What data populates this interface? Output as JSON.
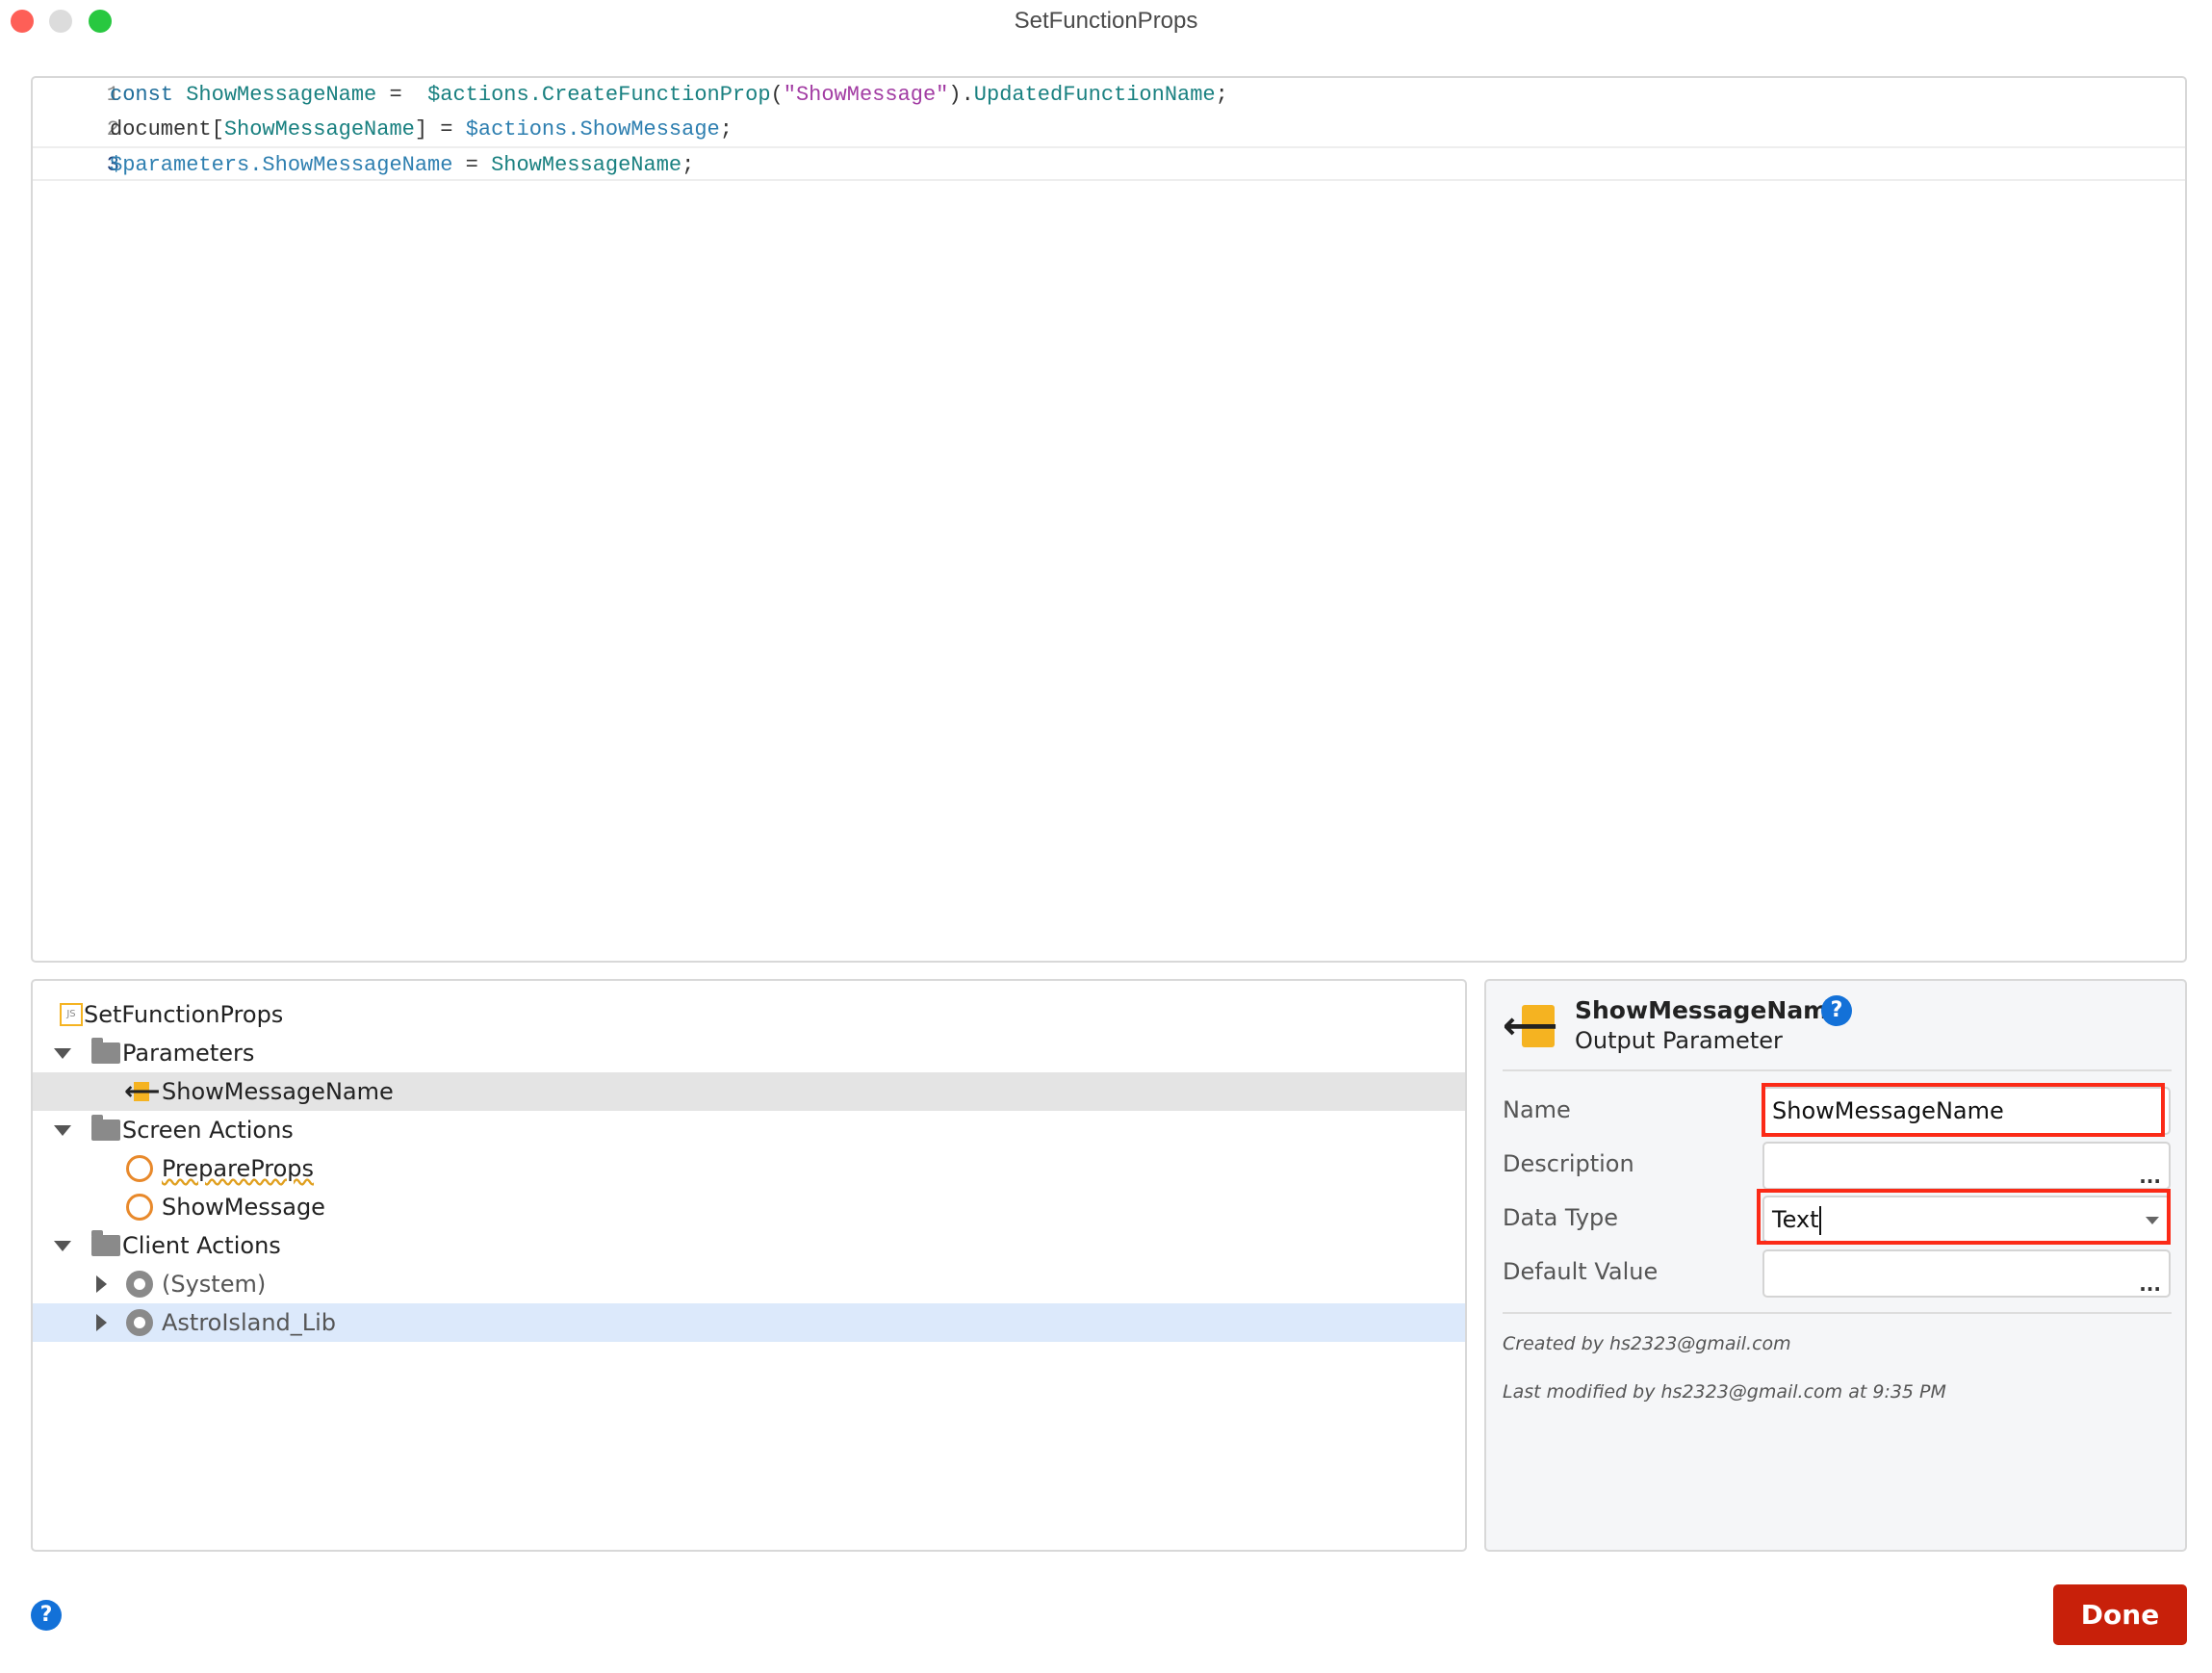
{
  "window": {
    "title": "SetFunctionProps"
  },
  "editor": {
    "lines": [
      {
        "num": "1",
        "tokens": [
          [
            "k",
            "const "
          ],
          [
            "v",
            "ShowMessageName"
          ],
          [
            "p",
            " =  "
          ],
          [
            "v",
            "$actions.CreateFunctionProp"
          ],
          [
            "p",
            "("
          ],
          [
            "s",
            "\"ShowMessage\""
          ],
          [
            "p",
            ")."
          ],
          [
            "v",
            "UpdatedFunctionName"
          ],
          [
            "p",
            ";"
          ]
        ]
      },
      {
        "num": "2",
        "tokens": [
          [
            "p",
            "document["
          ],
          [
            "v",
            "ShowMessageName"
          ],
          [
            "p",
            "] = "
          ],
          [
            "t",
            "$actions.ShowMessage"
          ],
          [
            "p",
            ";"
          ]
        ]
      },
      {
        "num": "3",
        "tokens": [
          [
            "t",
            "$parameters.ShowMessageName"
          ],
          [
            "p",
            " = "
          ],
          [
            "v",
            "ShowMessageName"
          ],
          [
            "p",
            ";"
          ]
        ]
      }
    ]
  },
  "tree": {
    "root": "SetFunctionProps",
    "root_icon": "JS",
    "parameters": "Parameters",
    "param_item": "ShowMessageName",
    "screen_actions": "Screen Actions",
    "screen_items": [
      "PrepareProps",
      "ShowMessage"
    ],
    "client_actions": "Client Actions",
    "client_items": [
      "(System)",
      "AstroIsland_Lib"
    ]
  },
  "props": {
    "title": "ShowMessageName",
    "subtitle": "Output Parameter",
    "fields": {
      "name_label": "Name",
      "name_value": "ShowMessageName",
      "description_label": "Description",
      "description_value": "",
      "datatype_label": "Data Type",
      "datatype_value": "Text",
      "default_label": "Default Value",
      "default_value": ""
    },
    "created": "Created by hs2323@gmail.com",
    "modified": "Last modified by hs2323@gmail.com at 9:35 PM",
    "ellipsis": "..."
  },
  "footer": {
    "help": "?",
    "done": "Done"
  },
  "colors": {
    "accent": "#1371d8",
    "done": "#c8200a",
    "highlight": "#fb2a17"
  }
}
